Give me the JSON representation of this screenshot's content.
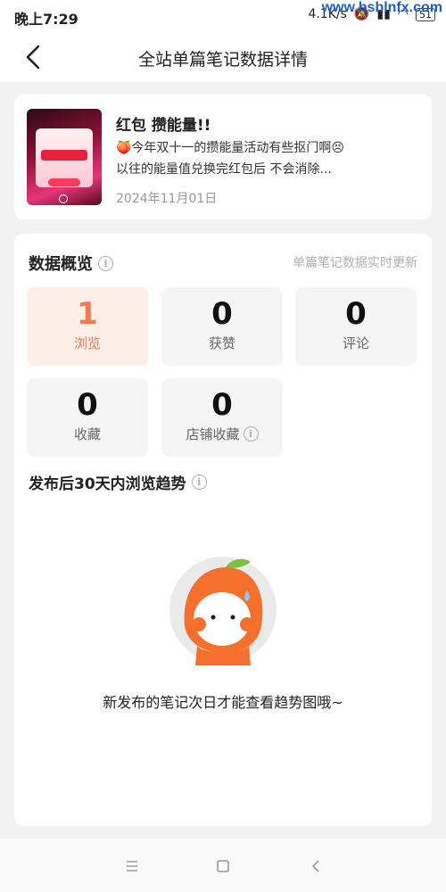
{
  "status": {
    "time": "晚上7:29",
    "net_speed": "4.1K/s",
    "battery": "51",
    "watermark": "www.bsblnfx.com"
  },
  "header": {
    "title": "全站单篇笔记数据详情"
  },
  "note": {
    "title": "红包 攒能量!!",
    "desc_line1": "🍑今年双十一的攒能量活动有些抠门啊😣",
    "desc_line2": "以往的能量值兑换完红包后 不会消除...",
    "date": "2024年11月01日"
  },
  "overview": {
    "title": "数据概览",
    "realtime_note": "单篇笔记数据实时更新",
    "stats": [
      {
        "value": "1",
        "label": "浏览"
      },
      {
        "value": "0",
        "label": "获赞"
      },
      {
        "value": "0",
        "label": "评论"
      },
      {
        "value": "0",
        "label": "收藏"
      },
      {
        "value": "0",
        "label": "店铺收藏"
      }
    ]
  },
  "trend": {
    "title": "发布后30天内浏览趋势",
    "empty_text": "新发布的笔记次日才能查看趋势图哦~"
  },
  "colors": {
    "accent": "#f07a52",
    "accent_bg": "#fdeee8"
  }
}
